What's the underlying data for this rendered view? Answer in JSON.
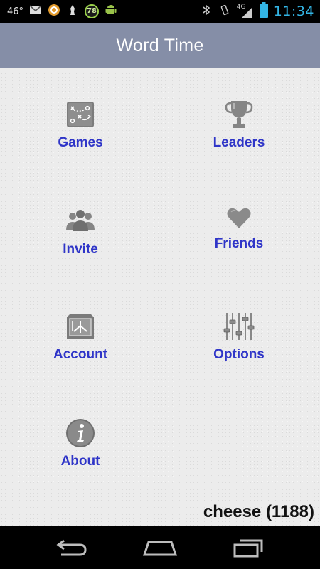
{
  "status_bar": {
    "temperature": "46°",
    "badge_count": "78",
    "network": "4G",
    "time": "11:34"
  },
  "app": {
    "title": "Word Time"
  },
  "menu": {
    "items": [
      {
        "label": "Games",
        "icon": "playbook-icon"
      },
      {
        "label": "Leaders",
        "icon": "trophy-icon"
      },
      {
        "label": "Invite",
        "icon": "people-icon"
      },
      {
        "label": "Friends",
        "icon": "heart-icon"
      },
      {
        "label": "Account",
        "icon": "account-icon"
      },
      {
        "label": "Options",
        "icon": "sliders-icon"
      },
      {
        "label": "About",
        "icon": "info-icon"
      }
    ]
  },
  "user": {
    "status": "cheese (1188)"
  },
  "colors": {
    "action_bar": "#858ea7",
    "menu_label": "#2f35c8",
    "status_time": "#33b5e5",
    "content_bg": "#ececec"
  }
}
